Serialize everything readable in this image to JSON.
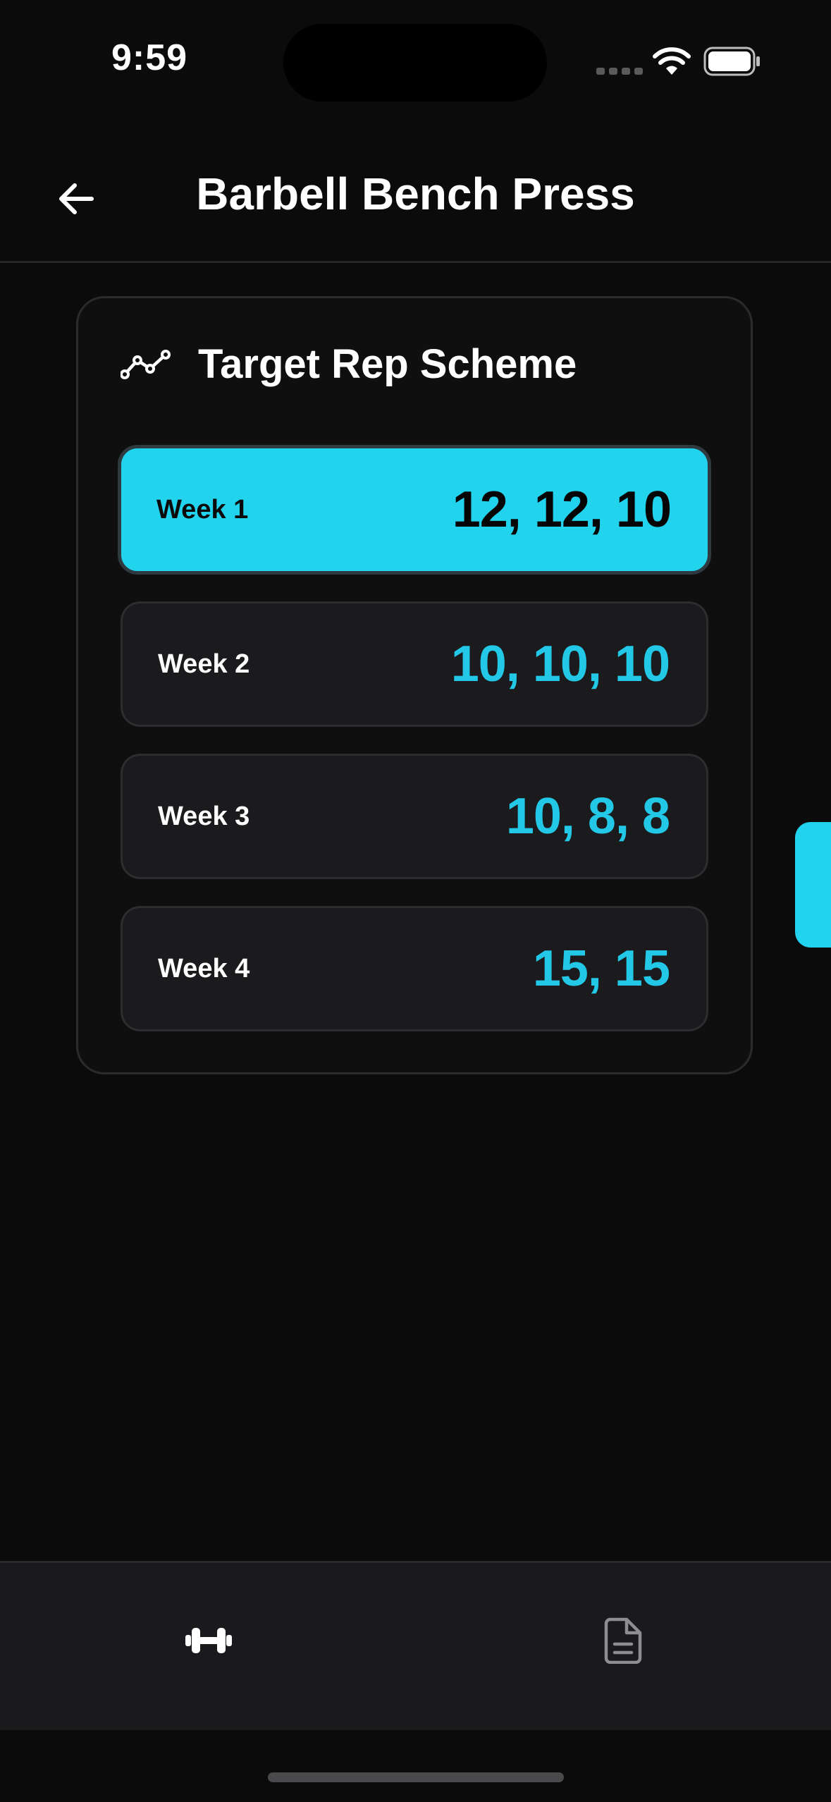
{
  "status_bar": {
    "time": "9:59"
  },
  "header": {
    "title": "Barbell Bench Press",
    "back_icon": "arrow-left-icon"
  },
  "rep_scheme": {
    "title": "Target Rep Scheme",
    "icon": "trend-line-icon",
    "weeks": [
      {
        "label": "Week 1",
        "reps": "12, 12, 10",
        "selected": true
      },
      {
        "label": "Week 2",
        "reps": "10, 10, 10",
        "selected": false
      },
      {
        "label": "Week 3",
        "reps": "10, 8, 8",
        "selected": false
      },
      {
        "label": "Week 4",
        "reps": "15, 15",
        "selected": false
      }
    ]
  },
  "tab_bar": {
    "tabs": [
      {
        "icon": "dumbbell-icon",
        "active": true
      },
      {
        "icon": "document-icon",
        "active": false
      }
    ]
  },
  "colors": {
    "accent": "#22d3ee",
    "background": "#0b0b0b",
    "card": "#0f0f10",
    "row": "#1b1b1e"
  }
}
